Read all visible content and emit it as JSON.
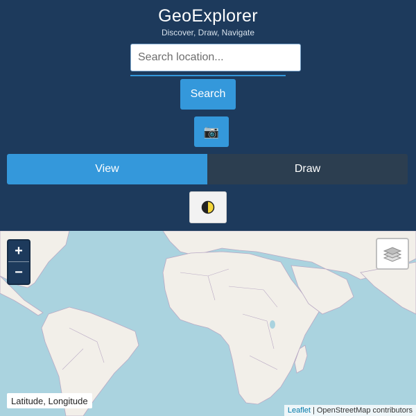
{
  "header": {
    "title": "GeoExplorer",
    "subtitle": "Discover, Draw, Navigate"
  },
  "search": {
    "placeholder": "Search location...",
    "value": "",
    "button_label": "Search"
  },
  "camera_button": {
    "icon": "camera-icon",
    "glyph": "📷"
  },
  "mode_tabs": [
    {
      "label": "View",
      "active": true
    },
    {
      "label": "Draw",
      "active": false
    }
  ],
  "theme_toggle": {
    "icon": "contrast-icon"
  },
  "map": {
    "zoom_in_label": "+",
    "zoom_out_label": "−",
    "layers_icon": "layers-icon",
    "coordinates_label": "Latitude, Longitude",
    "attribution": {
      "link_text": "Leaflet",
      "separator": "|",
      "credit": "OpenStreetMap contributors"
    }
  },
  "colors": {
    "header_bg": "#1d3a5c",
    "accent": "#3498db",
    "tab_inactive": "#2c3e50",
    "water": "#aad3df",
    "land": "#f2efe9"
  }
}
